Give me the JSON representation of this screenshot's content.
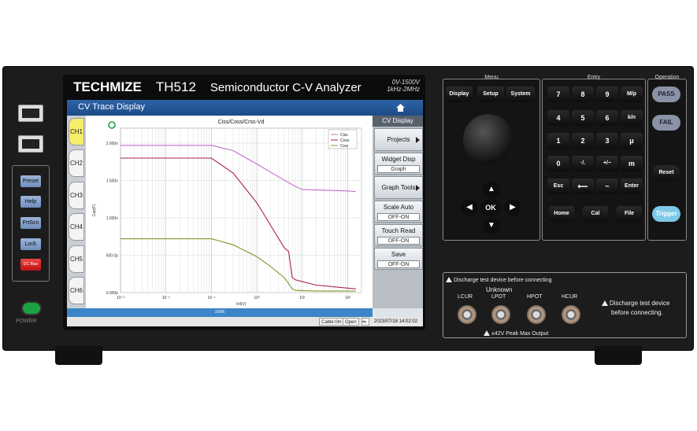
{
  "brand": {
    "logo_text": "TECHMIZE",
    "model": "TH512",
    "description": "Semiconductor C-V Analyzer"
  },
  "specs": {
    "voltage": "0V-1500V",
    "frequency": "1kHz-2MHz"
  },
  "screen": {
    "title": "CV Trace Display",
    "channels": [
      "CH1",
      "CH2",
      "CH3",
      "CH4",
      "CH5",
      "CH6"
    ],
    "active_channel": "CH1",
    "progress": "100%",
    "status": {
      "cable": "Cable:0m",
      "mode": "Open",
      "datetime": "2023/07/18 14:02:02"
    },
    "side_menu": {
      "header": "CV Display",
      "items": [
        {
          "label": "Projects"
        },
        {
          "label": "Widget Disp",
          "value": "Graph"
        },
        {
          "label": "Graph Tools"
        },
        {
          "label": "Scale Auto",
          "value": "OFF-ON"
        },
        {
          "label": "Touch Read",
          "value": "OFF-ON"
        },
        {
          "label": "Save",
          "value": "OFF-ON"
        }
      ]
    }
  },
  "left_buttons": [
    "Preset",
    "Help",
    "PrtScn",
    "Lock",
    "DC Bias"
  ],
  "power_label": "POWER",
  "menu_panel": {
    "title": "Menu",
    "buttons": [
      "Display",
      "Setup",
      "System"
    ],
    "ok": "OK"
  },
  "entry_panel": {
    "title": "Entry",
    "keys": [
      "7",
      "8",
      "9",
      "M/p",
      "4",
      "5",
      "6",
      "k/n",
      "1",
      "2",
      "3",
      "μ",
      "0",
      "·/.",
      "+/−",
      "m",
      "Esc",
      "⟵",
      "~",
      "Enter",
      "Home",
      "Cal",
      "File"
    ]
  },
  "operation_panel": {
    "title": "Operation",
    "buttons": [
      "PASS",
      "FAIL",
      "Reset",
      "Trigger"
    ]
  },
  "terminal_panel": {
    "top_warning": "Discharge test device before connecting",
    "unknown": "Unknown",
    "terminals": [
      "LCUR",
      "LPOT",
      "HPOT",
      "HCUR"
    ],
    "bottom_warning": "±42V Peak Max Output",
    "side_warning_1": "Discharge test device",
    "side_warning_2": "before connecting."
  },
  "chart_data": {
    "type": "line",
    "title": "Ciss/Coss/Crss-Vd",
    "xlabel": "Vd(V)",
    "ylabel": "Cap(F)",
    "x_scale": "log",
    "xlim": [
      0.001,
      200
    ],
    "ylim": [
      0,
      2.2e-09
    ],
    "xticks": [
      "10⁻³",
      "10⁻²",
      "10⁻¹",
      "10⁰",
      "10¹",
      "10²"
    ],
    "yticks": [
      "0.000p",
      "500.0p",
      "1.000n",
      "1.500n",
      "2.000n"
    ],
    "grid": true,
    "legend_position": "top-right",
    "series": [
      {
        "name": "Ciss",
        "color": "#c070c8",
        "x": [
          0.001,
          0.1,
          0.3,
          1,
          3,
          7,
          10,
          30,
          100,
          150
        ],
        "y": [
          1.97e-09,
          1.97e-09,
          1.9e-09,
          1.72e-09,
          1.55e-09,
          1.42e-09,
          1.38e-09,
          1.37e-09,
          1.36e-09,
          1.35e-09
        ]
      },
      {
        "name": "Coss",
        "color": "#a8204a",
        "x": [
          0.001,
          0.1,
          0.3,
          1,
          2,
          4,
          5,
          6,
          7,
          20,
          150
        ],
        "y": [
          1.8e-09,
          1.8e-09,
          1.6e-09,
          1.2e-09,
          9e-10,
          6e-10,
          5.5e-10,
          2e-10,
          1.7e-10,
          1e-10,
          5e-11
        ]
      },
      {
        "name": "Crss",
        "color": "#7f9b2a",
        "x": [
          0.001,
          0.1,
          0.3,
          1,
          2,
          4,
          5,
          6,
          7,
          20,
          150
        ],
        "y": [
          7.2e-10,
          7.2e-10,
          6.4e-10,
          4.8e-10,
          3.5e-10,
          2e-10,
          1.2e-10,
          5e-11,
          3e-11,
          2e-11,
          2e-11
        ]
      }
    ]
  }
}
